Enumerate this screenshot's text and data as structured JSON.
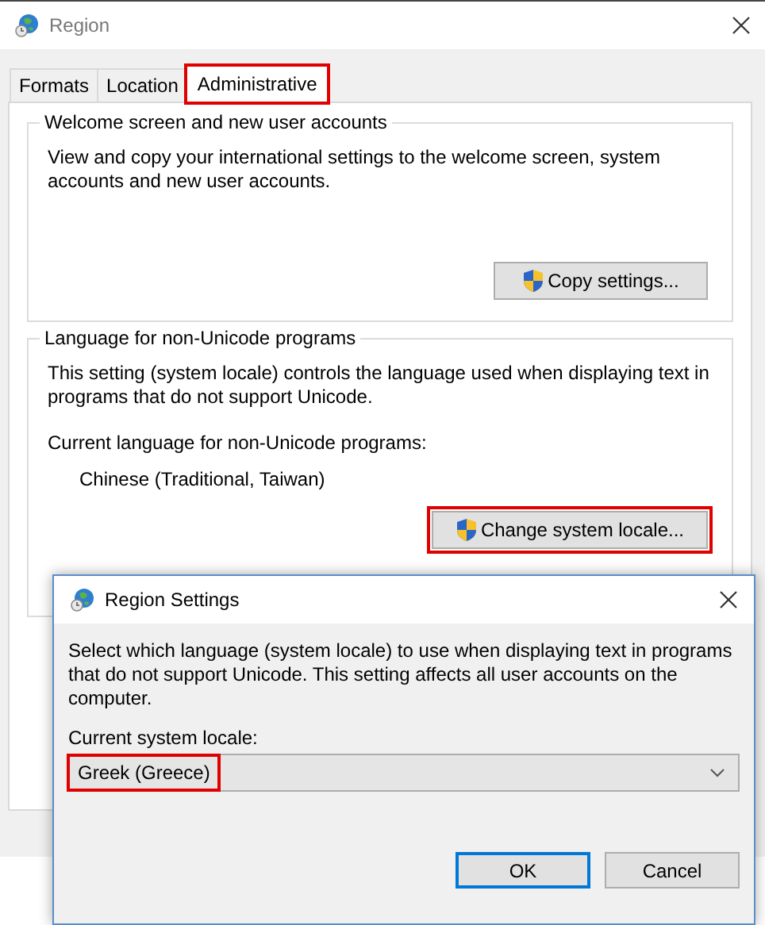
{
  "window": {
    "title": "Region"
  },
  "tabs": [
    {
      "label": "Formats",
      "selected": false,
      "highlighted": false
    },
    {
      "label": "Location",
      "selected": false,
      "highlighted": false
    },
    {
      "label": "Administrative",
      "selected": true,
      "highlighted": true
    }
  ],
  "welcome_group": {
    "title": "Welcome screen and new user accounts",
    "text": "View and copy your international settings to the welcome screen, system accounts and new user accounts.",
    "button": {
      "label": "Copy settings..."
    }
  },
  "language_group": {
    "title": "Language for non-Unicode programs",
    "text": "This setting (system locale) controls the language used when displaying text in programs that do not support Unicode.",
    "current_label": "Current language for non-Unicode programs:",
    "current_value": "Chinese (Traditional, Taiwan)",
    "button": {
      "label": "Change system locale...",
      "highlighted": true
    }
  },
  "dialog": {
    "title": "Region Settings",
    "description": "Select which language (system locale) to use when displaying text in programs that do not support Unicode. This setting affects all user accounts on the computer.",
    "field_label": "Current system locale:",
    "locale": {
      "value": "Greek (Greece)",
      "highlighted": true
    },
    "buttons": [
      {
        "label": "OK",
        "default": true
      },
      {
        "label": "Cancel",
        "default": false
      }
    ]
  }
}
